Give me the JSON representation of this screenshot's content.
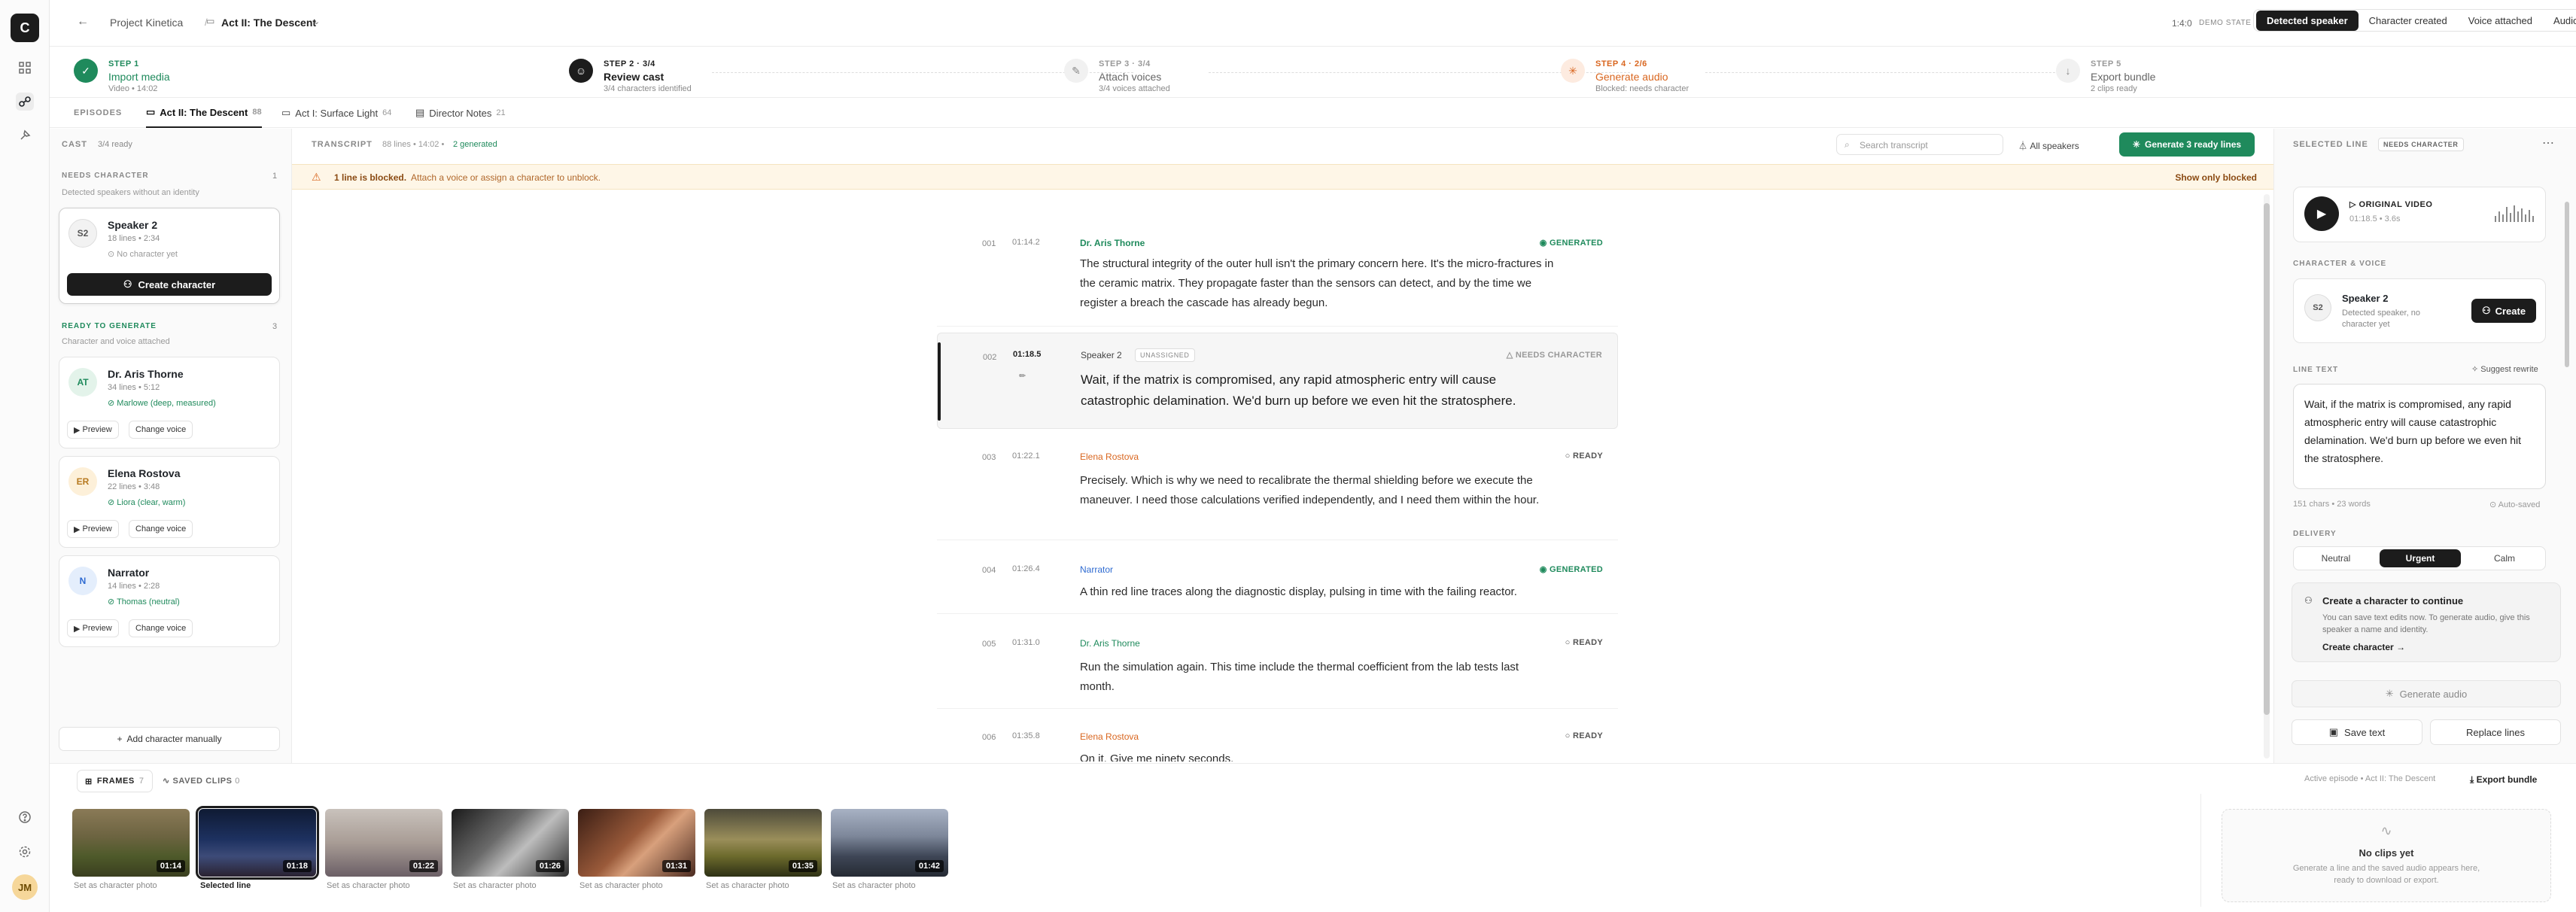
{
  "rail": {
    "logo": "C",
    "avatar": "JM",
    "icons": [
      "grid-icon",
      "waveform-icon",
      "mic-icon",
      "help-icon",
      "settings-icon"
    ]
  },
  "topbar": {
    "project": "Project Kinetica",
    "episode": "Act II: The Descent",
    "time": "1:4:0",
    "demo_label": "DEMO STATE",
    "states": [
      "Detected speaker",
      "Character created",
      "Voice attached",
      "Audio-only import"
    ]
  },
  "steps": [
    {
      "num": "STEP 1",
      "title": "Import media",
      "sub": "Video • 14:02"
    },
    {
      "num": "STEP 2 · 3/4",
      "title": "Review cast",
      "sub": "3/4 characters identified"
    },
    {
      "num": "STEP 3 · 3/4",
      "title": "Attach voices",
      "sub": "3/4 voices attached"
    },
    {
      "num": "STEP 4 · 2/6",
      "title": "Generate audio",
      "sub": "Blocked: needs character"
    },
    {
      "num": "STEP 5",
      "title": "Export bundle",
      "sub": "2 clips ready"
    }
  ],
  "episodes": {
    "label": "EPISODES",
    "tabs": [
      {
        "name": "Act II: The Descent",
        "count": "88"
      },
      {
        "name": "Act I: Surface Light",
        "count": "64"
      },
      {
        "name": "Director Notes",
        "count": "21"
      }
    ]
  },
  "cast": {
    "label": "CAST",
    "ready": "3/4 ready",
    "needs": {
      "label": "NEEDS CHARACTER",
      "count": "1",
      "sub": "Detected speakers without an identity",
      "card": {
        "initials": "S2",
        "name": "Speaker 2",
        "meta": "18 lines • 2:34",
        "status": "No character yet",
        "button": "Create character"
      }
    },
    "ready_group": {
      "label": "READY TO GENERATE",
      "count": "3",
      "sub": "Character and voice attached"
    },
    "cards": [
      {
        "initials": "AT",
        "name": "Dr. Aris Thorne",
        "meta": "34 lines • 5:12",
        "voice": "Marlowe (deep, measured)"
      },
      {
        "initials": "ER",
        "name": "Elena Rostova",
        "meta": "22 lines • 3:48",
        "voice": "Liora (clear, warm)"
      },
      {
        "initials": "N",
        "name": "Narrator",
        "meta": "14 lines • 2:28",
        "voice": "Thomas (neutral)"
      }
    ],
    "preview": "Preview",
    "change": "Change voice",
    "add": "Add character manually"
  },
  "transcript": {
    "label": "TRANSCRIPT",
    "meta": "88 lines • 14:02 •",
    "generated": "2 generated",
    "search": "Search transcript",
    "filter": "All speakers",
    "gen_btn": "Generate 3 ready lines",
    "banner_bold": "1 line is blocked.",
    "banner_text": "Attach a voice or assign a character to unblock.",
    "banner_link": "Show only blocked",
    "lines": [
      {
        "num": "001",
        "time": "01:14.2",
        "speaker": "Dr. Aris Thorne",
        "status": "GENERATED",
        "text": "The structural integrity of the outer hull isn't the primary concern here. It's the micro-fractures in the ceramic matrix. They propagate faster than the sensors can detect, and by the time we register a breach the cascade has already begun."
      },
      {
        "num": "002",
        "time": "01:18.5",
        "speaker": "Speaker 2",
        "tag": "UNASSIGNED",
        "status": "NEEDS CHARACTER",
        "text": "Wait, if the matrix is compromised, any rapid atmospheric entry will cause catastrophic delamination. We'd burn up before we even hit the stratosphere."
      },
      {
        "num": "003",
        "time": "01:22.1",
        "speaker": "Elena Rostova",
        "status": "READY",
        "text": "Precisely. Which is why we need to recalibrate the thermal shielding before we execute the maneuver. I need those calculations verified independently, and I need them within the hour."
      },
      {
        "num": "004",
        "time": "01:26.4",
        "speaker": "Narrator",
        "status": "GENERATED",
        "text": "A thin red line traces along the diagnostic display, pulsing in time with the failing reactor."
      },
      {
        "num": "005",
        "time": "01:31.0",
        "speaker": "Dr. Aris Thorne",
        "status": "READY",
        "text": "Run the simulation again. This time include the thermal coefficient from the lab tests last month."
      },
      {
        "num": "006",
        "time": "01:35.8",
        "speaker": "Elena Rostova",
        "status": "READY",
        "text": "On it. Give me ninety seconds."
      }
    ]
  },
  "right": {
    "label": "SELECTED LINE",
    "badge": "NEEDS CHARACTER",
    "video_title": "ORIGINAL VIDEO",
    "video_meta": "01:18.5 • 3.6s",
    "cv_label": "CHARACTER & VOICE",
    "spk_initials": "S2",
    "spk_name": "Speaker 2",
    "spk_sub": "Detected speaker, no character yet",
    "create": "Create",
    "lt_label": "LINE TEXT",
    "suggest": "Suggest rewrite",
    "line_text": "Wait, if the matrix is compromised, any rapid atmospheric entry will cause catastrophic delamination. We'd burn up before we even hit the stratosphere.",
    "counts": "151 chars • 23 words",
    "autosaved": "Auto-saved",
    "delivery_label": "DELIVERY",
    "delivery": [
      "Neutral",
      "Urgent",
      "Calm"
    ],
    "cta_title": "Create a character to continue",
    "cta_text": "You can save text edits now. To generate audio, give this speaker a name and identity.",
    "cta_link": "Create character",
    "gen_audio": "Generate audio",
    "save_text": "Save text",
    "replace": "Replace lines"
  },
  "bottom": {
    "frames": "FRAMES",
    "frames_count": "7",
    "saved": "SAVED CLIPS",
    "saved_count": "0",
    "active": "Active episode • Act II: The Descent",
    "export": "Export bundle",
    "thumbs": [
      {
        "time": "01:14",
        "label": "Set as character photo"
      },
      {
        "time": "01:18",
        "label": "Selected line"
      },
      {
        "time": "01:22",
        "label": "Set as character photo"
      },
      {
        "time": "01:26",
        "label": "Set as character photo"
      },
      {
        "time": "01:31",
        "label": "Set as character photo"
      },
      {
        "time": "01:35",
        "label": "Set as character photo"
      },
      {
        "time": "01:42",
        "label": "Set as character photo"
      }
    ],
    "noclips": "No clips yet",
    "noclips_sub1": "Generate a line and the saved audio appears here,",
    "noclips_sub2": "ready to download or export."
  },
  "colors": {
    "green": "#1f8a5c",
    "orange": "#d9661f",
    "accent_btn": "#1f8a5c"
  }
}
